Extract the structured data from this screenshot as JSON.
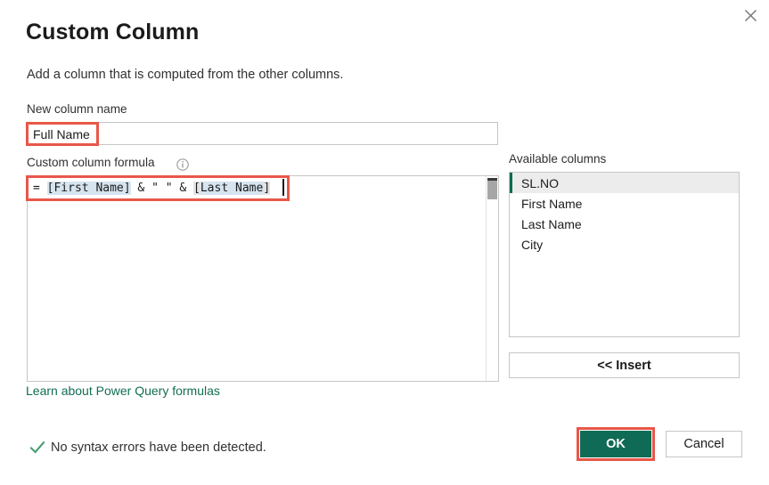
{
  "dialog": {
    "title": "Custom Column",
    "subtitle": "Add a column that is computed from the other columns.",
    "close_icon": "close-icon"
  },
  "new_column": {
    "label": "New column name",
    "value": "Full Name",
    "placeholder": ""
  },
  "formula": {
    "label": "Custom column formula",
    "info_icon": "info-circle-icon",
    "prefix": "= ",
    "text": "= [First Name] & \" \" & [Last Name]",
    "segments": {
      "equals": "= ",
      "ref1": "[First Name]",
      "op1": " & ",
      "quote": "\" \"",
      "op2": " & ",
      "ref2_open": "[",
      "ref2_body": "Last Name",
      "ref2_close": "]"
    },
    "learn_link": "Learn about Power Query formulas"
  },
  "available_columns": {
    "label": "Available columns",
    "items": [
      {
        "label": "SL.NO",
        "selected": true
      },
      {
        "label": "First Name",
        "selected": false
      },
      {
        "label": "Last Name",
        "selected": false
      },
      {
        "label": "City",
        "selected": false
      }
    ],
    "insert_button": "<< Insert"
  },
  "status": {
    "icon": "checkmark-icon",
    "message": "No syntax errors have been detected."
  },
  "footer": {
    "ok_label": "OK",
    "cancel_label": "Cancel"
  },
  "colors": {
    "accent_green": "#0f6b55",
    "link_green": "#106e54",
    "check_green": "#4a9c72",
    "annotation_red": "#e8574a",
    "selected_row_bg": "#ececec",
    "ref_highlight": "#d6e4f0",
    "border_gray": "#c8c6c4"
  }
}
